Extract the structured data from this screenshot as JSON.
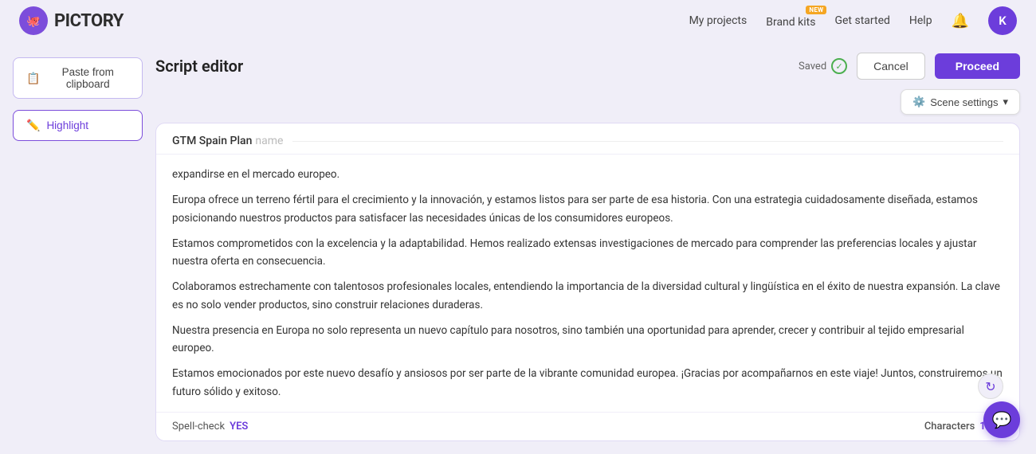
{
  "navbar": {
    "logo_text": "PICTORY",
    "links": [
      {
        "id": "my-projects",
        "label": "My projects"
      },
      {
        "id": "brand-kits",
        "label": "Brand kits",
        "badge": "NEW"
      },
      {
        "id": "get-started",
        "label": "Get started"
      },
      {
        "id": "help",
        "label": "Help"
      }
    ],
    "avatar_letter": "K"
  },
  "sidebar": {
    "paste_label": "Paste from clipboard",
    "highlight_label": "Highlight"
  },
  "editor": {
    "title": "Script editor",
    "saved_label": "Saved",
    "cancel_label": "Cancel",
    "proceed_label": "Proceed",
    "scene_settings_label": "Scene settings",
    "project_name": "GTM Spain Plan",
    "project_name_placeholder": "name",
    "paragraphs": [
      "expandirse en el mercado europeo.",
      "Europa ofrece un terreno fértil para el crecimiento y la innovación, y estamos listos para ser parte de esa historia. Con una estrategia cuidadosamente diseñada, estamos posicionando nuestros productos para satisfacer las necesidades únicas de los consumidores europeos.",
      "Estamos comprometidos con la excelencia y la adaptabilidad. Hemos realizado extensas investigaciones de mercado para comprender las preferencias locales y ajustar nuestra oferta en consecuencia.",
      "Colaboramos estrechamente con talentosos profesionales locales, entendiendo la importancia de la diversidad cultural y lingüística en el éxito de nuestra expansión. La clave es no solo vender productos, sino construir relaciones duraderas.",
      "Nuestra presencia en Europa no solo representa un nuevo capítulo para nosotros, sino también una oportunidad para aprender, crecer y contribuir al tejido empresarial europeo.",
      "Estamos emocionados por este nuevo desafío y ansiosos por ser parte de la vibrante comunidad europea. ¡Gracias por acompañarnos en este viaje! Juntos, construiremos un futuro sólido y exitoso."
    ],
    "spell_check_label": "Spell-check",
    "spell_check_value": "YES",
    "characters_label": "Characters",
    "characters_count": "1221"
  }
}
